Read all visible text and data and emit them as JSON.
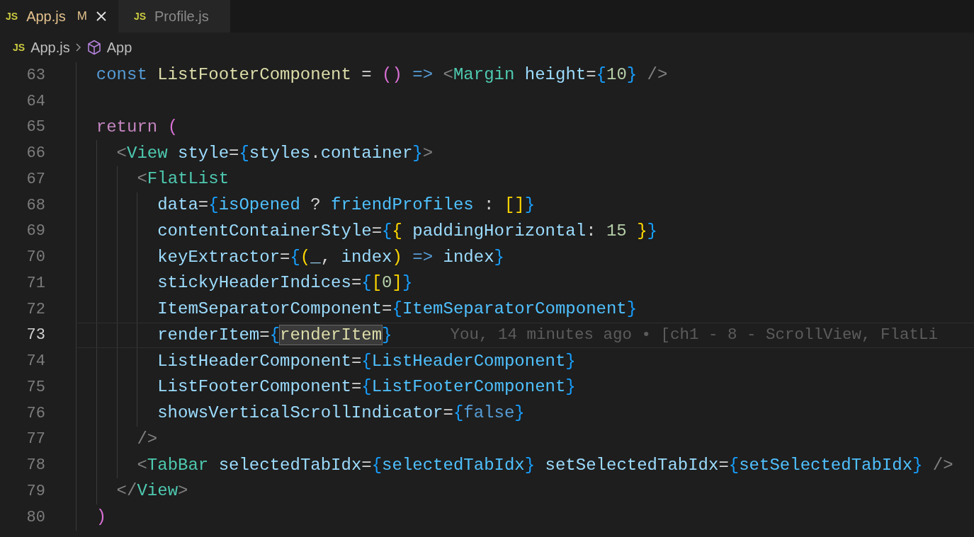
{
  "tabs": [
    {
      "icon": "JS",
      "label": "App.js",
      "badge": "M",
      "modified": true,
      "selected": true
    },
    {
      "icon": "JS",
      "label": "Profile.js",
      "modified": false,
      "selected": false
    }
  ],
  "breadcrumb": [
    {
      "kind": "file",
      "icon": "JS",
      "label": "App.js"
    },
    {
      "kind": "symbol",
      "label": "App"
    }
  ],
  "lines": [
    {
      "number": "63",
      "current": false,
      "tokens": [
        {
          "text": "  const ",
          "kind": "kw"
        },
        {
          "text": "ListFooterComponent",
          "kind": "fn"
        },
        {
          "text": " = ",
          "kind": "plain"
        },
        {
          "text": "() ",
          "kind": "br2"
        },
        {
          "text": "=> ",
          "kind": "kw"
        },
        {
          "text": "<",
          "kind": "punct"
        },
        {
          "text": "Margin ",
          "kind": "tag"
        },
        {
          "text": "height",
          "kind": "attr"
        },
        {
          "text": "=",
          "kind": "plain"
        },
        {
          "text": "{",
          "kind": "br3"
        },
        {
          "text": "10",
          "kind": "num"
        },
        {
          "text": "}",
          "kind": "br3"
        },
        {
          "text": " />",
          "kind": "punct"
        }
      ]
    },
    {
      "number": "64",
      "current": false
    },
    {
      "number": "65",
      "current": false,
      "tokens": [
        {
          "text": "  return ",
          "kind": "ctl"
        },
        {
          "text": "(",
          "kind": "br2"
        }
      ]
    },
    {
      "number": "66",
      "current": false,
      "tokens": [
        {
          "text": "    <",
          "kind": "punct"
        },
        {
          "text": "View ",
          "kind": "tag"
        },
        {
          "text": "style",
          "kind": "attr"
        },
        {
          "text": "=",
          "kind": "plain"
        },
        {
          "text": "{",
          "kind": "br3"
        },
        {
          "text": "styles",
          "kind": "attr"
        },
        {
          "text": ".",
          "kind": "plain"
        },
        {
          "text": "container",
          "kind": "attr"
        },
        {
          "text": "}",
          "kind": "br3"
        },
        {
          "text": ">",
          "kind": "punct"
        }
      ]
    },
    {
      "number": "67",
      "current": false,
      "tokens": [
        {
          "text": "      <",
          "kind": "punct"
        },
        {
          "text": "FlatList",
          "kind": "tag"
        }
      ]
    },
    {
      "number": "68",
      "current": false,
      "tokens": [
        {
          "text": "        data",
          "kind": "attr"
        },
        {
          "text": "=",
          "kind": "plain"
        },
        {
          "text": "{",
          "kind": "br3"
        },
        {
          "text": "isOpened",
          "kind": "var"
        },
        {
          "text": " ? ",
          "kind": "plain"
        },
        {
          "text": "friendProfiles",
          "kind": "var"
        },
        {
          "text": " : ",
          "kind": "plain"
        },
        {
          "text": "[]",
          "kind": "br1"
        },
        {
          "text": "}",
          "kind": "br3"
        }
      ]
    },
    {
      "number": "69",
      "current": false,
      "tokens": [
        {
          "text": "        contentContainerStyle",
          "kind": "attr"
        },
        {
          "text": "=",
          "kind": "plain"
        },
        {
          "text": "{",
          "kind": "br3"
        },
        {
          "text": "{ ",
          "kind": "br1"
        },
        {
          "text": "paddingHorizontal",
          "kind": "attr"
        },
        {
          "text": ": ",
          "kind": "plain"
        },
        {
          "text": "15 ",
          "kind": "num"
        },
        {
          "text": "}",
          "kind": "br1"
        },
        {
          "text": "}",
          "kind": "br3"
        }
      ]
    },
    {
      "number": "70",
      "current": false,
      "tokens": [
        {
          "text": "        keyExtractor",
          "kind": "attr"
        },
        {
          "text": "=",
          "kind": "plain"
        },
        {
          "text": "{",
          "kind": "br3"
        },
        {
          "text": "(",
          "kind": "br1"
        },
        {
          "text": "_",
          "kind": "attr"
        },
        {
          "text": ", ",
          "kind": "plain"
        },
        {
          "text": "index",
          "kind": "attr"
        },
        {
          "text": ") ",
          "kind": "br1"
        },
        {
          "text": "=> ",
          "kind": "kw"
        },
        {
          "text": "index",
          "kind": "attr"
        },
        {
          "text": "}",
          "kind": "br3"
        }
      ]
    },
    {
      "number": "71",
      "current": false,
      "tokens": [
        {
          "text": "        stickyHeaderIndices",
          "kind": "attr"
        },
        {
          "text": "=",
          "kind": "plain"
        },
        {
          "text": "{",
          "kind": "br3"
        },
        {
          "text": "[",
          "kind": "br1"
        },
        {
          "text": "0",
          "kind": "num"
        },
        {
          "text": "]",
          "kind": "br1"
        },
        {
          "text": "}",
          "kind": "br3"
        }
      ]
    },
    {
      "number": "72",
      "current": false,
      "tokens": [
        {
          "text": "        ItemSeparatorComponent",
          "kind": "attr"
        },
        {
          "text": "=",
          "kind": "plain"
        },
        {
          "text": "{",
          "kind": "br3"
        },
        {
          "text": "ItemSeparatorComponent",
          "kind": "var"
        },
        {
          "text": "}",
          "kind": "br3"
        }
      ]
    },
    {
      "number": "73",
      "current": true,
      "blame": "You, 14 minutes ago • [ch1 - 8 - ScrollView, FlatLi",
      "tokens": [
        {
          "text": "        renderItem",
          "kind": "attr"
        },
        {
          "text": "=",
          "kind": "plain"
        },
        {
          "text": "{",
          "kind": "br3"
        },
        {
          "text": "renderItem",
          "kind": "match"
        },
        {
          "text": "}",
          "kind": "br3"
        }
      ]
    },
    {
      "number": "74",
      "current": false,
      "tokens": [
        {
          "text": "        ListHeaderComponent",
          "kind": "attr"
        },
        {
          "text": "=",
          "kind": "plain"
        },
        {
          "text": "{",
          "kind": "br3"
        },
        {
          "text": "ListHeaderComponent",
          "kind": "var"
        },
        {
          "text": "}",
          "kind": "br3"
        }
      ]
    },
    {
      "number": "75",
      "current": false,
      "tokens": [
        {
          "text": "        ListFooterComponent",
          "kind": "attr"
        },
        {
          "text": "=",
          "kind": "plain"
        },
        {
          "text": "{",
          "kind": "br3"
        },
        {
          "text": "ListFooterComponent",
          "kind": "var"
        },
        {
          "text": "}",
          "kind": "br3"
        }
      ]
    },
    {
      "number": "76",
      "current": false,
      "tokens": [
        {
          "text": "        showsVerticalScrollIndicator",
          "kind": "attr"
        },
        {
          "text": "=",
          "kind": "plain"
        },
        {
          "text": "{",
          "kind": "br3"
        },
        {
          "text": "false",
          "kind": "kw"
        },
        {
          "text": "}",
          "kind": "br3"
        }
      ]
    },
    {
      "number": "77",
      "current": false,
      "tokens": [
        {
          "text": "      />",
          "kind": "punct"
        }
      ]
    },
    {
      "number": "78",
      "current": false,
      "tokens": [
        {
          "text": "      <",
          "kind": "punct"
        },
        {
          "text": "TabBar ",
          "kind": "tag"
        },
        {
          "text": "selectedTabIdx",
          "kind": "attr"
        },
        {
          "text": "=",
          "kind": "plain"
        },
        {
          "text": "{",
          "kind": "br3"
        },
        {
          "text": "selectedTabIdx",
          "kind": "var"
        },
        {
          "text": "} ",
          "kind": "br3"
        },
        {
          "text": "setSelectedTabIdx",
          "kind": "attr"
        },
        {
          "text": "=",
          "kind": "plain"
        },
        {
          "text": "{",
          "kind": "br3"
        },
        {
          "text": "setSelectedTabIdx",
          "kind": "var"
        },
        {
          "text": "}",
          "kind": "br3"
        },
        {
          "text": " />",
          "kind": "punct"
        }
      ]
    },
    {
      "number": "79",
      "current": false,
      "tokens": [
        {
          "text": "    </",
          "kind": "punct"
        },
        {
          "text": "View",
          "kind": "tag"
        },
        {
          "text": ">",
          "kind": "punct"
        }
      ]
    },
    {
      "number": "80",
      "current": false,
      "tokens": [
        {
          "text": "  )",
          "kind": "br2"
        }
      ]
    }
  ]
}
